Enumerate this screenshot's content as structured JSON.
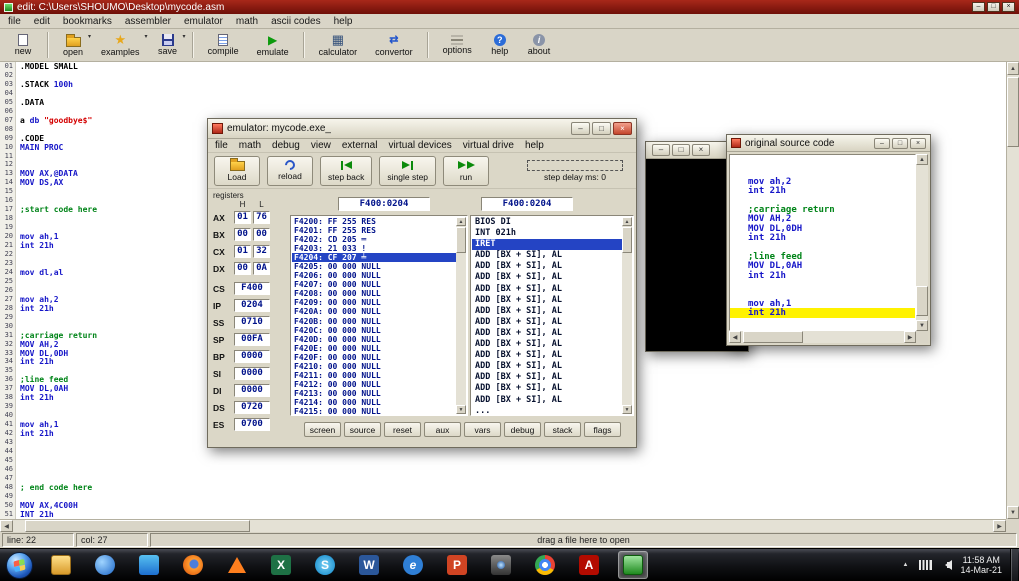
{
  "glyphs": {
    "dropdown": "▾",
    "arrow_up": "▲",
    "arrow_down": "▼",
    "arrow_left": "◀",
    "arrow_right": "▶",
    "minimize": "–",
    "maximize": "□",
    "close": "×"
  },
  "app": {
    "title": "edit: C:\\Users\\SHOUMO\\Desktop\\mycode.asm",
    "menu": [
      "file",
      "edit",
      "bookmarks",
      "assembler",
      "emulator",
      "math",
      "ascii codes",
      "help"
    ],
    "toolbar": [
      {
        "label": "new",
        "icon": "new-file-icon"
      },
      {
        "label": "open",
        "icon": "open-folder-icon",
        "dropdown": true
      },
      {
        "label": "examples",
        "icon": "examples-icon",
        "glyph": "★",
        "dropdown": true
      },
      {
        "label": "save",
        "icon": "save-icon",
        "dropdown": true
      },
      {
        "label": "compile",
        "icon": "compile-icon"
      },
      {
        "label": "emulate",
        "icon": "emulate-icon",
        "glyph": "▶"
      },
      {
        "label": "calculator",
        "icon": "calculator-icon",
        "glyph": "▦"
      },
      {
        "label": "convertor",
        "icon": "convertor-icon",
        "glyph": "⇄"
      },
      {
        "label": "options",
        "icon": "options-icon"
      },
      {
        "label": "help",
        "icon": "help-icon",
        "glyph": "?"
      },
      {
        "label": "about",
        "icon": "about-icon",
        "glyph": "i"
      }
    ],
    "status": {
      "line": "line: 22",
      "col": "col: 27",
      "hint": "drag a file here to open"
    }
  },
  "editor": {
    "lines": [
      {
        "n": "01",
        "t": [
          [
            ".MODEL SMALL",
            "k"
          ]
        ]
      },
      {
        "n": "02",
        "t": []
      },
      {
        "n": "03",
        "t": [
          [
            ".STACK ",
            "k"
          ],
          [
            "100h",
            "b"
          ]
        ]
      },
      {
        "n": "04",
        "t": []
      },
      {
        "n": "05",
        "t": [
          [
            ".DATA",
            "k"
          ]
        ]
      },
      {
        "n": "06",
        "t": []
      },
      {
        "n": "07",
        "t": [
          [
            "a ",
            "k"
          ],
          [
            "db ",
            "b"
          ],
          [
            "\"goodbye$\"",
            "r"
          ]
        ]
      },
      {
        "n": "08",
        "t": []
      },
      {
        "n": "09",
        "t": [
          [
            ".CODE",
            "k"
          ]
        ]
      },
      {
        "n": "10",
        "t": [
          [
            "MAIN PROC",
            "b"
          ]
        ]
      },
      {
        "n": "11",
        "t": []
      },
      {
        "n": "12",
        "t": []
      },
      {
        "n": "13",
        "t": [
          [
            "MOV AX,@DATA",
            "b"
          ]
        ]
      },
      {
        "n": "14",
        "t": [
          [
            "MOV DS,AX",
            "b"
          ]
        ]
      },
      {
        "n": "15",
        "t": []
      },
      {
        "n": "16",
        "t": []
      },
      {
        "n": "17",
        "t": [
          [
            ";start code here",
            "g"
          ]
        ]
      },
      {
        "n": "18",
        "t": []
      },
      {
        "n": "19",
        "t": []
      },
      {
        "n": "20",
        "t": [
          [
            "mov ah,1",
            "b"
          ]
        ]
      },
      {
        "n": "21",
        "t": [
          [
            "int 21h",
            "b"
          ]
        ]
      },
      {
        "n": "22",
        "t": []
      },
      {
        "n": "23",
        "t": []
      },
      {
        "n": "24",
        "t": [
          [
            "mov dl,al",
            "b"
          ]
        ]
      },
      {
        "n": "25",
        "t": []
      },
      {
        "n": "26",
        "t": []
      },
      {
        "n": "27",
        "t": [
          [
            "mov ah,2",
            "b"
          ]
        ]
      },
      {
        "n": "28",
        "t": [
          [
            "int 21h",
            "b"
          ]
        ]
      },
      {
        "n": "29",
        "t": []
      },
      {
        "n": "30",
        "t": []
      },
      {
        "n": "31",
        "t": [
          [
            ";carriage return",
            "g"
          ]
        ]
      },
      {
        "n": "32",
        "t": [
          [
            "MOV AH,2",
            "b"
          ]
        ]
      },
      {
        "n": "33",
        "t": [
          [
            "MOV DL,0DH",
            "b"
          ]
        ]
      },
      {
        "n": "34",
        "t": [
          [
            "int 21h",
            "b"
          ]
        ]
      },
      {
        "n": "35",
        "t": []
      },
      {
        "n": "36",
        "t": [
          [
            ";line feed",
            "g"
          ]
        ]
      },
      {
        "n": "37",
        "t": [
          [
            "MOV DL,0AH",
            "b"
          ]
        ]
      },
      {
        "n": "38",
        "t": [
          [
            "int 21h",
            "b"
          ]
        ]
      },
      {
        "n": "39",
        "t": []
      },
      {
        "n": "40",
        "t": []
      },
      {
        "n": "41",
        "t": [
          [
            "mov ah,1",
            "b"
          ]
        ]
      },
      {
        "n": "42",
        "t": [
          [
            "int 21h",
            "b"
          ]
        ]
      },
      {
        "n": "43",
        "t": []
      },
      {
        "n": "44",
        "t": []
      },
      {
        "n": "45",
        "t": []
      },
      {
        "n": "46",
        "t": []
      },
      {
        "n": "47",
        "t": []
      },
      {
        "n": "48",
        "t": [
          [
            "; end code here",
            "g"
          ]
        ]
      },
      {
        "n": "49",
        "t": []
      },
      {
        "n": "50",
        "t": [
          [
            "MOV AX,4C00H",
            "b"
          ]
        ]
      },
      {
        "n": "51",
        "t": [
          [
            "INT 21h",
            "b"
          ]
        ]
      }
    ]
  },
  "emulator": {
    "title": "emulator: mycode.exe_",
    "menu": [
      "file",
      "math",
      "debug",
      "view",
      "external",
      "virtual devices",
      "virtual drive",
      "help"
    ],
    "toolbar": [
      {
        "label": "Load",
        "icon": "load-icon"
      },
      {
        "label": "reload",
        "icon": "reload-icon"
      },
      {
        "label": "step back",
        "icon": "step-back-icon"
      },
      {
        "label": "single step",
        "icon": "single-step-icon"
      },
      {
        "label": "run",
        "icon": "run-icon"
      }
    ],
    "step_delay_label": "step delay ms: 0",
    "registers": {
      "title": "registers",
      "col_h": "H",
      "col_l": "L",
      "rows": [
        {
          "name": "AX",
          "h": "01",
          "l": "76"
        },
        {
          "name": "BX",
          "h": "00",
          "l": "00"
        },
        {
          "name": "CX",
          "h": "01",
          "l": "32"
        },
        {
          "name": "DX",
          "h": "00",
          "l": "0A"
        },
        {
          "name": "CS",
          "v": "F400"
        },
        {
          "name": "IP",
          "v": "0204"
        },
        {
          "name": "SS",
          "v": "0710"
        },
        {
          "name": "SP",
          "v": "00FA"
        },
        {
          "name": "BP",
          "v": "0000"
        },
        {
          "name": "SI",
          "v": "0000"
        },
        {
          "name": "DI",
          "v": "0000"
        },
        {
          "name": "DS",
          "v": "0720"
        },
        {
          "name": "ES",
          "v": "0700"
        }
      ]
    },
    "mem_addr_left": "F400:0204",
    "mem_addr_right": "F400:0204",
    "memory_rows": [
      {
        "a": "F4200:",
        "v": "FF 255 RES"
      },
      {
        "a": "F4201:",
        "v": "FF 255 RES"
      },
      {
        "a": "F4202:",
        "v": "CD 205 ═"
      },
      {
        "a": "F4203:",
        "v": "21 033 !"
      },
      {
        "a": "F4204:",
        "v": "CF 207 ╧",
        "sel": true
      },
      {
        "a": "F4205:",
        "v": "00 000 NULL"
      },
      {
        "a": "F4206:",
        "v": "00 000 NULL"
      },
      {
        "a": "F4207:",
        "v": "00 000 NULL"
      },
      {
        "a": "F4208:",
        "v": "00 000 NULL"
      },
      {
        "a": "F4209:",
        "v": "00 000 NULL"
      },
      {
        "a": "F420A:",
        "v": "00 000 NULL"
      },
      {
        "a": "F420B:",
        "v": "00 000 NULL"
      },
      {
        "a": "F420C:",
        "v": "00 000 NULL"
      },
      {
        "a": "F420D:",
        "v": "00 000 NULL"
      },
      {
        "a": "F420E:",
        "v": "00 000 NULL"
      },
      {
        "a": "F420F:",
        "v": "00 000 NULL"
      },
      {
        "a": "F4210:",
        "v": "00 000 NULL"
      },
      {
        "a": "F4211:",
        "v": "00 000 NULL"
      },
      {
        "a": "F4212:",
        "v": "00 000 NULL"
      },
      {
        "a": "F4213:",
        "v": "00 000 NULL"
      },
      {
        "a": "F4214:",
        "v": "00 000 NULL"
      },
      {
        "a": "F4215:",
        "v": "00 000 NULL"
      }
    ],
    "disasm_rows": [
      {
        "t": "BIOS DI"
      },
      {
        "t": "INT 021h"
      },
      {
        "t": "IRET",
        "sel": true
      },
      {
        "t": "ADD [BX + SI], AL"
      },
      {
        "t": "ADD [BX + SI], AL"
      },
      {
        "t": "ADD [BX + SI], AL"
      },
      {
        "t": "ADD [BX + SI], AL"
      },
      {
        "t": "ADD [BX + SI], AL"
      },
      {
        "t": "ADD [BX + SI], AL"
      },
      {
        "t": "ADD [BX + SI], AL"
      },
      {
        "t": "ADD [BX + SI], AL"
      },
      {
        "t": "ADD [BX + SI], AL"
      },
      {
        "t": "ADD [BX + SI], AL"
      },
      {
        "t": "ADD [BX + SI], AL"
      },
      {
        "t": "ADD [BX + SI], AL"
      },
      {
        "t": "ADD [BX + SI], AL"
      },
      {
        "t": "ADD [BX + SI], AL"
      },
      {
        "t": "..."
      }
    ],
    "bottom_buttons": [
      "screen",
      "source",
      "reset",
      "aux",
      "vars",
      "debug",
      "stack",
      "flags"
    ]
  },
  "source_window": {
    "title": "original source code",
    "lines": [
      {
        "t": []
      },
      {
        "t": []
      },
      {
        "t": [
          [
            "mov ah,2",
            "b"
          ]
        ]
      },
      {
        "t": [
          [
            "int 21h",
            "b"
          ]
        ]
      },
      {
        "t": []
      },
      {
        "t": [
          [
            ";carriage return",
            "g"
          ]
        ]
      },
      {
        "t": [
          [
            "MOV AH,2",
            "b"
          ]
        ]
      },
      {
        "t": [
          [
            "MOV DL,0DH",
            "b"
          ]
        ]
      },
      {
        "t": [
          [
            "int 21h",
            "b"
          ]
        ]
      },
      {
        "t": []
      },
      {
        "t": [
          [
            ";line feed",
            "g"
          ]
        ]
      },
      {
        "t": [
          [
            "MOV DL,0AH",
            "b"
          ]
        ]
      },
      {
        "t": [
          [
            "int 21h",
            "b"
          ]
        ]
      },
      {
        "t": []
      },
      {
        "t": []
      },
      {
        "t": [
          [
            "mov ah,1",
            "b"
          ]
        ]
      },
      {
        "t": [
          [
            "int 21h",
            "b"
          ]
        ],
        "hl": true
      }
    ]
  },
  "taskbar": {
    "icons": [
      {
        "name": "explorer",
        "style": "explorer"
      },
      {
        "name": "media-player",
        "style": "wmp"
      },
      {
        "name": "messenger",
        "style": "msgr"
      },
      {
        "name": "firefox",
        "style": "firefox"
      },
      {
        "name": "vlc",
        "style": "vlc"
      },
      {
        "name": "excel",
        "style": "excel",
        "letter": "X"
      },
      {
        "name": "skype",
        "style": "skype",
        "letter": "S"
      },
      {
        "name": "word",
        "style": "word",
        "letter": "W"
      },
      {
        "name": "internet-explorer",
        "style": "ie",
        "letter": "e"
      },
      {
        "name": "powerpoint",
        "style": "ppt",
        "letter": "P"
      },
      {
        "name": "camera",
        "style": "camera"
      },
      {
        "name": "chrome",
        "style": "chrome"
      },
      {
        "name": "adobe-reader",
        "style": "adobe",
        "letter": "A"
      },
      {
        "name": "emu8086",
        "style": "emu",
        "active": true
      }
    ],
    "clock": {
      "time": "11:58 AM",
      "date": "14-Mar-21"
    }
  }
}
